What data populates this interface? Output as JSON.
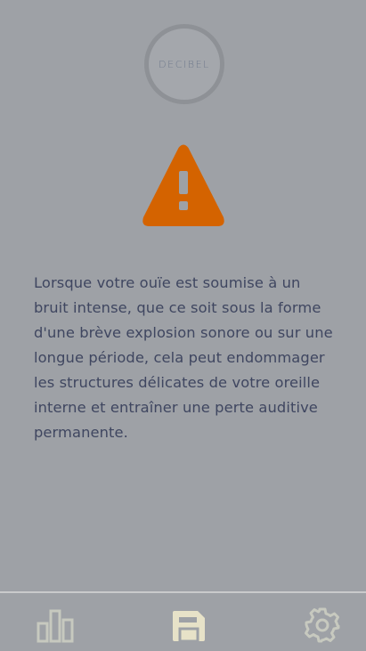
{
  "header": {
    "logo_text": "DECIBEL"
  },
  "alert": {
    "icon": "warning-triangle-icon",
    "icon_color": "#d46300",
    "message": "Lorsque votre ouïe est soumise à un bruit intense, que ce soit sous la forme d'une brève explosion sonore ou sur une longue période, cela peut endommager les structures délicates de votre oreille interne et entraîner une perte auditive permanente."
  },
  "tabbar": {
    "items": [
      {
        "icon": "bar-chart-icon",
        "active": false
      },
      {
        "icon": "save-icon",
        "active": true
      },
      {
        "icon": "gear-icon",
        "active": false
      }
    ],
    "active_color": "#e7e2c8",
    "inactive_color": "#c7c9bf"
  },
  "colors": {
    "background": "#9ea1a6",
    "text": "#3f4660"
  }
}
